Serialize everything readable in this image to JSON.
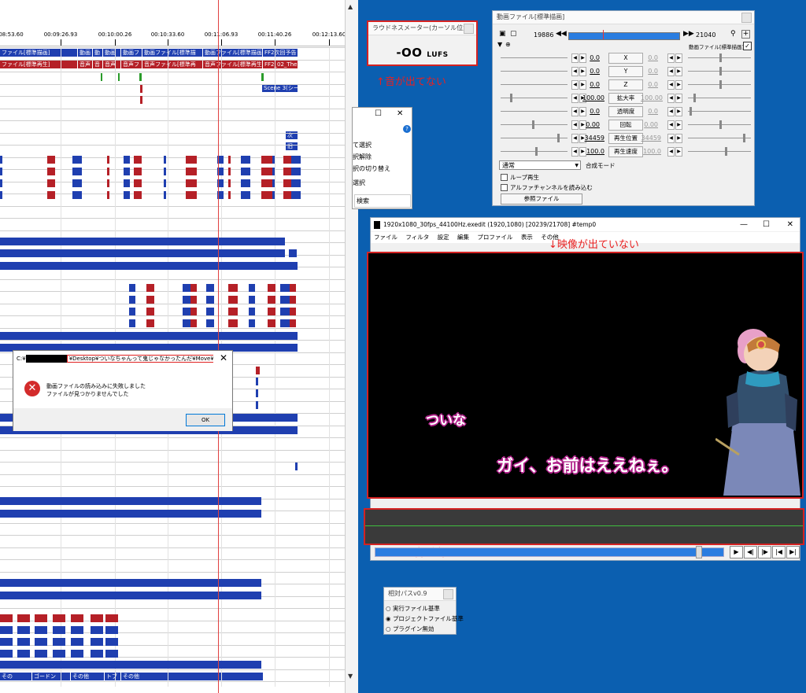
{
  "timeline": {
    "ruler_labels": [
      "08:53.60",
      "00:09:26.93",
      "00:10:00.26",
      "00:10:33.60",
      "00:11:06.93",
      "00:11:40.26",
      "00:12:13.60"
    ],
    "row1_clips": [
      "ファイル[標準描画]",
      "動画",
      "動",
      "動画",
      "動画フ",
      "動画ファイル[標準描",
      "動画ファイル[標準描画",
      "FF2次回予告"
    ],
    "row2_clips": [
      "ファイル[標準再生]",
      "音声",
      "音",
      "音声",
      "音声フ",
      "音声ファイル[標準再",
      "音声ファイル[標準再生",
      "FF2_02_The"
    ],
    "scene_label": "Scene 3(シー",
    "next_label": "次",
    "old_label": "旧",
    "bottom_labels": [
      "その",
      "ゴードン",
      "その他",
      "トブ",
      "その他"
    ]
  },
  "error_dialog": {
    "path_prefix": "C:¥",
    "path_highlight": "¥Desktop¥ついなちゃんって鬼じゃなかったんだ¥Move¥01_",
    "close": "✕",
    "icon": "✕",
    "message1": "動画ファイルの読み込みに失敗しました",
    "message2": "ファイルが見つかりませんでした",
    "ok": "OK"
  },
  "loudness": {
    "title": "ラウドネスメーター(カーソル位置)",
    "value": "-OO",
    "unit": "LUFS",
    "annotation": "↑音が出てない"
  },
  "partial_window": {
    "items": [
      "て選択",
      "択解除",
      "択の切り替え",
      "選択",
      "検索"
    ],
    "help": "?"
  },
  "properties": {
    "title": "動画ファイル[標準描画]",
    "frame_start": "19886",
    "frame_end": "21040",
    "checkbox_label": "動画ファイル[標準描画]",
    "rows": [
      {
        "label": "X",
        "v1": "0.0",
        "v2": "0.0"
      },
      {
        "label": "Y",
        "v1": "0.0",
        "v2": "0.0"
      },
      {
        "label": "Z",
        "v1": "0.0",
        "v2": "0.0"
      },
      {
        "label": "拡大率",
        "v1": "100.00",
        "v2": "100.00"
      },
      {
        "label": "透明度",
        "v1": "0.0",
        "v2": "0.0"
      },
      {
        "label": "回転",
        "v1": "0.00",
        "v2": "0.00"
      },
      {
        "label": "再生位置",
        "v1": "34459",
        "v2": "34459"
      },
      {
        "label": "再生速度",
        "v1": "100.0",
        "v2": "100.0"
      }
    ],
    "blend_value": "通常",
    "blend_label": "合成モード",
    "loop_label": "ループ再生",
    "alpha_label": "アルファチャンネルを読み込む",
    "ref_button": "参照ファイル"
  },
  "preview": {
    "title": "1920x1080_30fps_44100Hz.exedit (1920,1080)  [20239/21708]  #temp0",
    "menu": [
      "ファイル",
      "フィルタ",
      "設定",
      "編集",
      "プロファイル",
      "表示",
      "その他"
    ],
    "annotation_video": "↓映像が出ていない",
    "subtitle_name": "ついな",
    "subtitle_line": "ガイ、お前はええねぇ。",
    "annotation_audio": "↑音が出てない",
    "buttons": [
      "▶",
      "◀|",
      "|▶",
      "|◀",
      "▶|"
    ],
    "win_controls": [
      "—",
      "☐",
      "✕"
    ]
  },
  "relpath": {
    "title": "相対パスv0.9",
    "options": [
      "実行ファイル基準",
      "プロジェクトファイル基準",
      "プラグイン無効"
    ],
    "selected": 1
  }
}
